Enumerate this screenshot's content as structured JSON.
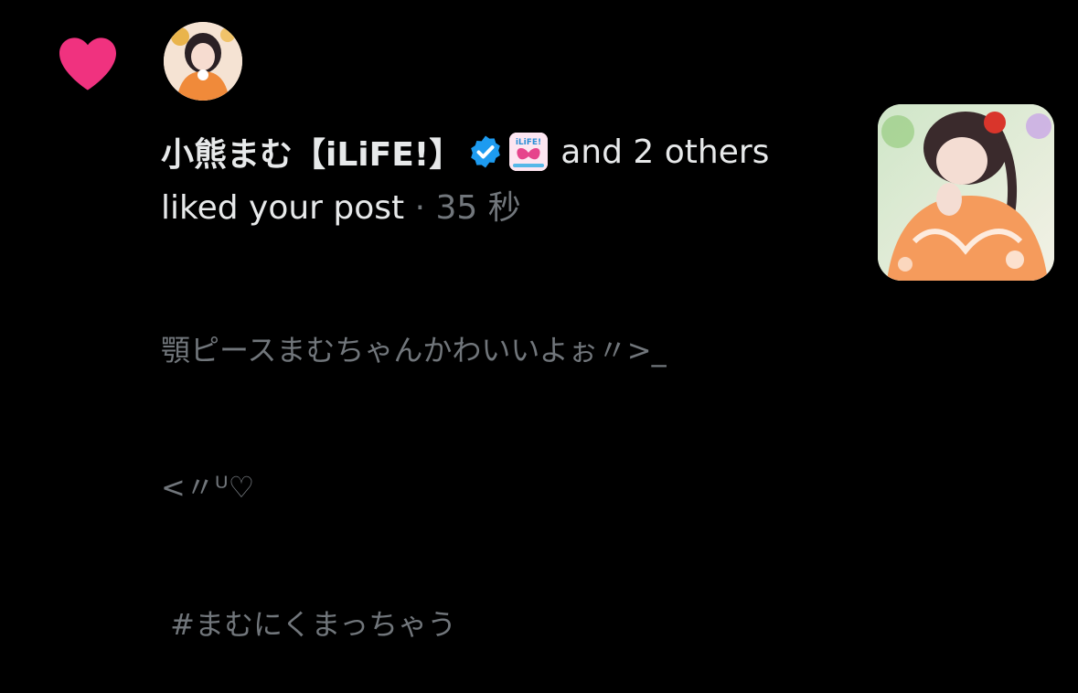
{
  "notification": {
    "user_name": "小熊まむ【iLiFE!】",
    "org_badge_text": "iLiFE!",
    "others_text": "and 2 others",
    "action_text": "liked your post",
    "separator": "·",
    "time_ago": "35 秒",
    "post_line1": "顎ピースまむちゃんかわいいよぉ〃>_",
    "post_line2": "<〃ᵁ♡",
    "post_line3": " #まむにくまっちゃう",
    "icons": {
      "type": "heart-icon",
      "verified": "verified-badge-icon"
    },
    "colors": {
      "heart": "#f0327f",
      "verified": "#1d9bf0",
      "secondary_text": "#71767b",
      "primary_text": "#e7e9ea"
    }
  }
}
